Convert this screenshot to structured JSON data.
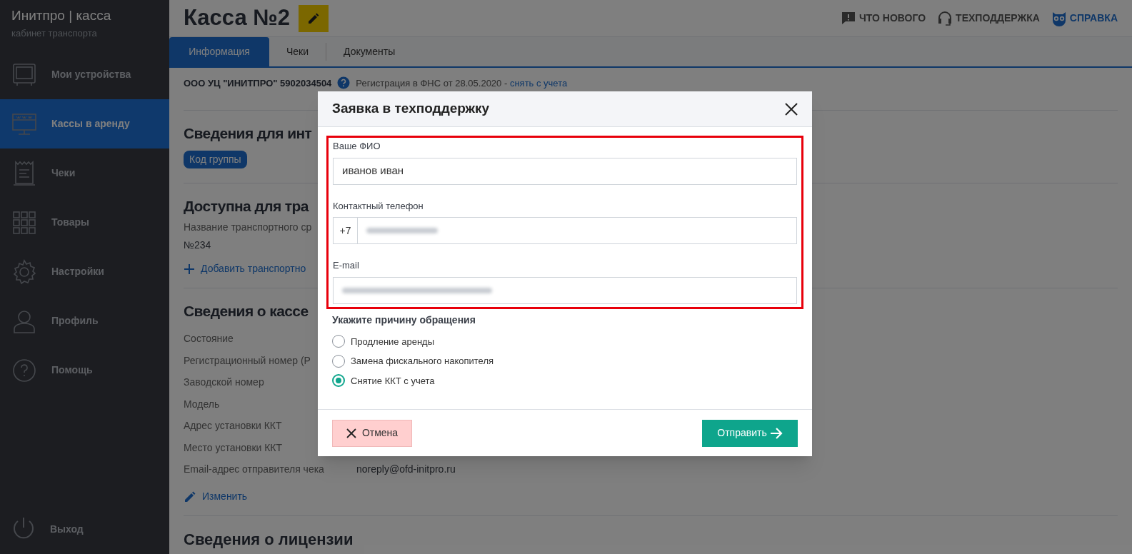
{
  "sidebar": {
    "logo": "**Инитпро** | касса",
    "subtitle": "кабинет транспорта",
    "items": [
      {
        "label": "Мои устройства",
        "selected": false
      },
      {
        "label": "Кассы в аренду",
        "selected": true
      },
      {
        "label": "Чеки",
        "selected": false
      },
      {
        "label": "Товары",
        "selected": false
      },
      {
        "label": "Настройки",
        "selected": false
      },
      {
        "label": "Профиль",
        "selected": false
      },
      {
        "label": "Помощь",
        "selected": false
      }
    ],
    "logout": "Выход"
  },
  "header": {
    "title": "Касса №2",
    "links": [
      {
        "label": "ЧТО НОВОГО",
        "kind": "plain"
      },
      {
        "label": "ТЕХПОДДЕРЖКА",
        "kind": "plain"
      },
      {
        "label": "СПРАВКА",
        "kind": "accent"
      }
    ]
  },
  "tabs": [
    {
      "label": "Информация",
      "selected": true
    },
    {
      "label": "Чеки",
      "selected": false
    },
    {
      "label": "Документы",
      "selected": false
    }
  ],
  "org": {
    "name": "ООО УЦ \"ИНИТПРО\" 5902034504",
    "registration": "Регистрация в ФНС от 28.05.2020 -",
    "unregister_link": "снять с учета"
  },
  "section_integration": {
    "title": "Сведения для инт",
    "badge": "Код группы"
  },
  "section_transport": {
    "title": "Доступна для тра",
    "label": "Название транспортного ср",
    "value": "№234",
    "add_link": "Добавить транспортно"
  },
  "section_kassa": {
    "title": "Сведения о кассе",
    "rows": [
      {
        "label": "Состояние"
      },
      {
        "label": "Регистрационный номер (Р"
      },
      {
        "label": "Заводской номер"
      },
      {
        "label": "Модель"
      },
      {
        "label": "Адрес установки ККТ"
      },
      {
        "label": "Место установки ККТ"
      },
      {
        "label": "Email-адрес отправителя чека",
        "value": "noreply@ofd-initpro.ru"
      }
    ],
    "edit_link": "Изменить"
  },
  "section_license": {
    "title": "Сведения о лицензии"
  },
  "modal": {
    "title": "Заявка в техподдержку",
    "name_label": "Ваше ФИО",
    "name_value": "иванов иван",
    "phone_label": "Контактный телефон",
    "phone_prefix": "+7",
    "email_label": "E-mail",
    "reason_label": "Укажите причину обращения",
    "reasons": [
      {
        "label": "Продление аренды",
        "selected": false
      },
      {
        "label": "Замена фискального накопителя",
        "selected": false
      },
      {
        "label": "Снятие ККТ с учета",
        "selected": true
      }
    ],
    "cancel": "Отмена",
    "submit": "Отправить"
  }
}
